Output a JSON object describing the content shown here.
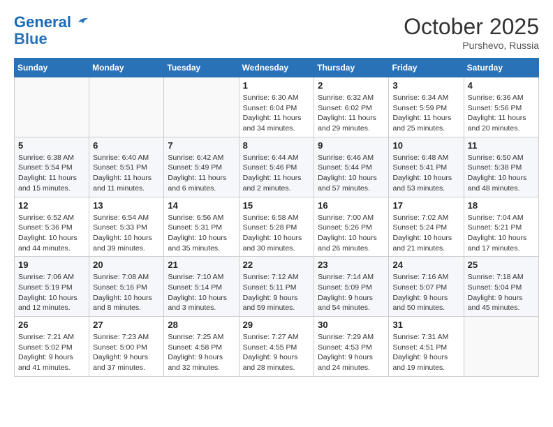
{
  "logo": {
    "line1": "General",
    "line2": "Blue"
  },
  "title": "October 2025",
  "location": "Purshevo, Russia",
  "days_header": [
    "Sunday",
    "Monday",
    "Tuesday",
    "Wednesday",
    "Thursday",
    "Friday",
    "Saturday"
  ],
  "weeks": [
    [
      {
        "day": "",
        "info": ""
      },
      {
        "day": "",
        "info": ""
      },
      {
        "day": "",
        "info": ""
      },
      {
        "day": "1",
        "info": "Sunrise: 6:30 AM\nSunset: 6:04 PM\nDaylight: 11 hours\nand 34 minutes."
      },
      {
        "day": "2",
        "info": "Sunrise: 6:32 AM\nSunset: 6:02 PM\nDaylight: 11 hours\nand 29 minutes."
      },
      {
        "day": "3",
        "info": "Sunrise: 6:34 AM\nSunset: 5:59 PM\nDaylight: 11 hours\nand 25 minutes."
      },
      {
        "day": "4",
        "info": "Sunrise: 6:36 AM\nSunset: 5:56 PM\nDaylight: 11 hours\nand 20 minutes."
      }
    ],
    [
      {
        "day": "5",
        "info": "Sunrise: 6:38 AM\nSunset: 5:54 PM\nDaylight: 11 hours\nand 15 minutes."
      },
      {
        "day": "6",
        "info": "Sunrise: 6:40 AM\nSunset: 5:51 PM\nDaylight: 11 hours\nand 11 minutes."
      },
      {
        "day": "7",
        "info": "Sunrise: 6:42 AM\nSunset: 5:49 PM\nDaylight: 11 hours\nand 6 minutes."
      },
      {
        "day": "8",
        "info": "Sunrise: 6:44 AM\nSunset: 5:46 PM\nDaylight: 11 hours\nand 2 minutes."
      },
      {
        "day": "9",
        "info": "Sunrise: 6:46 AM\nSunset: 5:44 PM\nDaylight: 10 hours\nand 57 minutes."
      },
      {
        "day": "10",
        "info": "Sunrise: 6:48 AM\nSunset: 5:41 PM\nDaylight: 10 hours\nand 53 minutes."
      },
      {
        "day": "11",
        "info": "Sunrise: 6:50 AM\nSunset: 5:38 PM\nDaylight: 10 hours\nand 48 minutes."
      }
    ],
    [
      {
        "day": "12",
        "info": "Sunrise: 6:52 AM\nSunset: 5:36 PM\nDaylight: 10 hours\nand 44 minutes."
      },
      {
        "day": "13",
        "info": "Sunrise: 6:54 AM\nSunset: 5:33 PM\nDaylight: 10 hours\nand 39 minutes."
      },
      {
        "day": "14",
        "info": "Sunrise: 6:56 AM\nSunset: 5:31 PM\nDaylight: 10 hours\nand 35 minutes."
      },
      {
        "day": "15",
        "info": "Sunrise: 6:58 AM\nSunset: 5:28 PM\nDaylight: 10 hours\nand 30 minutes."
      },
      {
        "day": "16",
        "info": "Sunrise: 7:00 AM\nSunset: 5:26 PM\nDaylight: 10 hours\nand 26 minutes."
      },
      {
        "day": "17",
        "info": "Sunrise: 7:02 AM\nSunset: 5:24 PM\nDaylight: 10 hours\nand 21 minutes."
      },
      {
        "day": "18",
        "info": "Sunrise: 7:04 AM\nSunset: 5:21 PM\nDaylight: 10 hours\nand 17 minutes."
      }
    ],
    [
      {
        "day": "19",
        "info": "Sunrise: 7:06 AM\nSunset: 5:19 PM\nDaylight: 10 hours\nand 12 minutes."
      },
      {
        "day": "20",
        "info": "Sunrise: 7:08 AM\nSunset: 5:16 PM\nDaylight: 10 hours\nand 8 minutes."
      },
      {
        "day": "21",
        "info": "Sunrise: 7:10 AM\nSunset: 5:14 PM\nDaylight: 10 hours\nand 3 minutes."
      },
      {
        "day": "22",
        "info": "Sunrise: 7:12 AM\nSunset: 5:11 PM\nDaylight: 9 hours\nand 59 minutes."
      },
      {
        "day": "23",
        "info": "Sunrise: 7:14 AM\nSunset: 5:09 PM\nDaylight: 9 hours\nand 54 minutes."
      },
      {
        "day": "24",
        "info": "Sunrise: 7:16 AM\nSunset: 5:07 PM\nDaylight: 9 hours\nand 50 minutes."
      },
      {
        "day": "25",
        "info": "Sunrise: 7:18 AM\nSunset: 5:04 PM\nDaylight: 9 hours\nand 45 minutes."
      }
    ],
    [
      {
        "day": "26",
        "info": "Sunrise: 7:21 AM\nSunset: 5:02 PM\nDaylight: 9 hours\nand 41 minutes."
      },
      {
        "day": "27",
        "info": "Sunrise: 7:23 AM\nSunset: 5:00 PM\nDaylight: 9 hours\nand 37 minutes."
      },
      {
        "day": "28",
        "info": "Sunrise: 7:25 AM\nSunset: 4:58 PM\nDaylight: 9 hours\nand 32 minutes."
      },
      {
        "day": "29",
        "info": "Sunrise: 7:27 AM\nSunset: 4:55 PM\nDaylight: 9 hours\nand 28 minutes."
      },
      {
        "day": "30",
        "info": "Sunrise: 7:29 AM\nSunset: 4:53 PM\nDaylight: 9 hours\nand 24 minutes."
      },
      {
        "day": "31",
        "info": "Sunrise: 7:31 AM\nSunset: 4:51 PM\nDaylight: 9 hours\nand 19 minutes."
      },
      {
        "day": "",
        "info": ""
      }
    ]
  ]
}
